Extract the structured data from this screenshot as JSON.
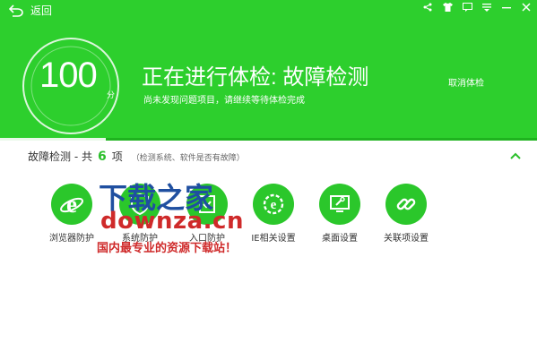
{
  "toolbar": {
    "back_label": "返回"
  },
  "window_controls": [
    "share-icon",
    "shirt-icon",
    "feedback-icon",
    "menu-icon",
    "minimize-icon",
    "close-icon"
  ],
  "score": {
    "value": "100",
    "unit": "分"
  },
  "header": {
    "title": "正在进行体检: 故障检测",
    "subtitle": "尚未发现问题项目，请继续等待体检完成",
    "cancel_label": "取消体检"
  },
  "section": {
    "label_prefix": "故障检测 - 共",
    "count": "6",
    "label_suffix": "项",
    "note": "（检测系统、软件是否有故障）"
  },
  "items": [
    {
      "label": "浏览器防护",
      "icon": "ie-icon"
    },
    {
      "label": "系统防护",
      "icon": "system-shield-icon"
    },
    {
      "label": "入口防护",
      "icon": "entry-shield-icon"
    },
    {
      "label": "IE相关设置",
      "icon": "ie-settings-icon"
    },
    {
      "label": "桌面设置",
      "icon": "desktop-settings-icon"
    },
    {
      "label": "关联项设置",
      "icon": "link-icon"
    }
  ],
  "watermark": {
    "line1": "下载之家",
    "line2": "downza.cn",
    "line3": "国内最专业的资源下载站！"
  },
  "colors": {
    "brand_green": "#2dcf2d",
    "item_green": "#2bc72b",
    "count_green": "#2bbf2b"
  }
}
